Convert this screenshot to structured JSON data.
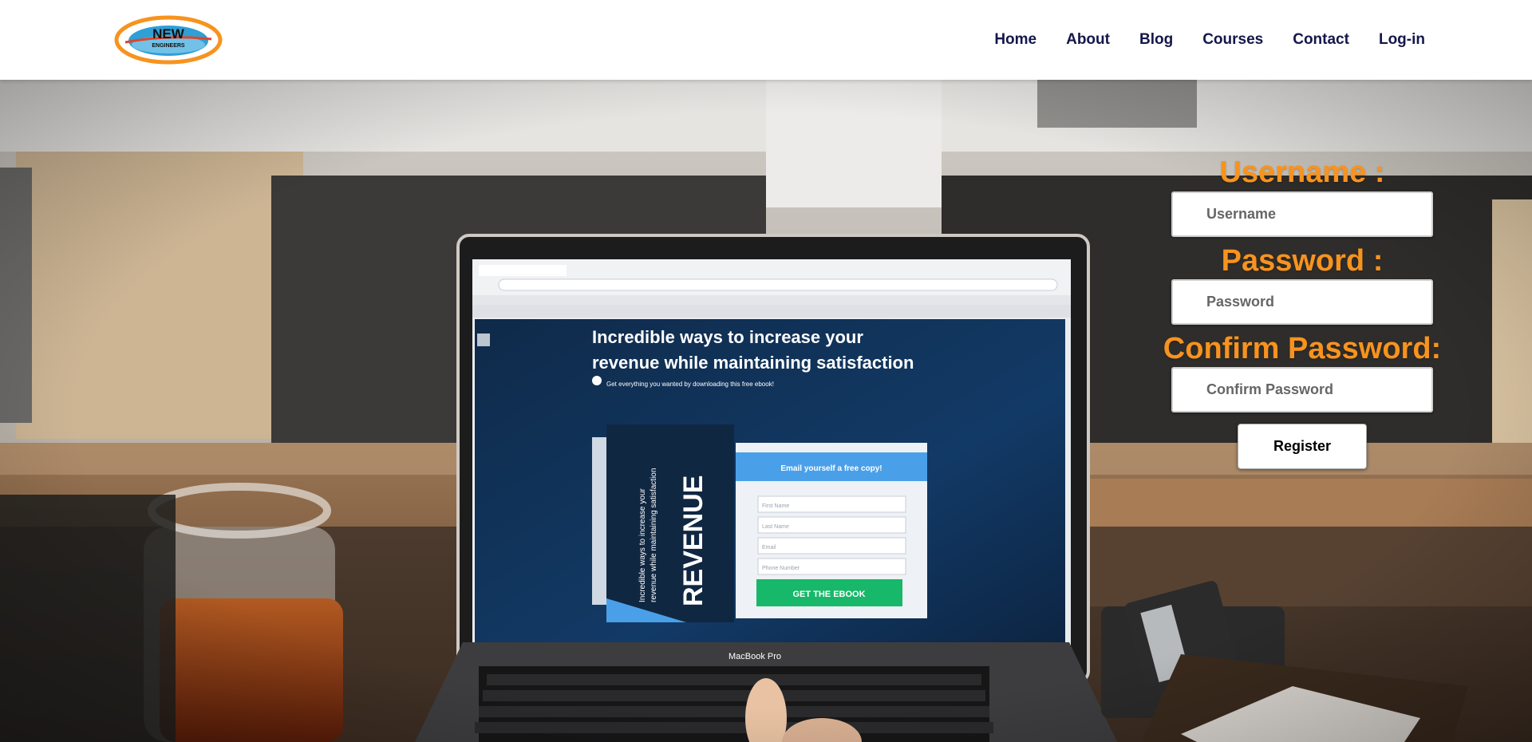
{
  "brand": {
    "logo_top": "NEW",
    "logo_bottom": "ENGINEERS",
    "colors": {
      "ring": "#f7931e",
      "disc": "#2f9fd6",
      "text": "#111111"
    }
  },
  "nav": {
    "home": "Home",
    "about": "About",
    "blog": "Blog",
    "courses": "Courses",
    "contact": "Contact",
    "login": "Log-in"
  },
  "screen": {
    "headline_1": "Incredible ways to increase your",
    "headline_2": "revenue while maintaining satisfaction",
    "subline": "Get everything you wanted by downloading this free ebook!",
    "book_title": "REVENUE",
    "book_sub_1": "Incredible ways to increase your",
    "book_sub_2": "revenue while maintaining satisfaction",
    "card_title": "Email yourself a free copy!",
    "field_1": "First Name",
    "field_2": "Last Name",
    "field_3": "Email",
    "field_4": "Phone Number",
    "cta": "GET THE EBOOK",
    "laptop_label": "MacBook Pro"
  },
  "form": {
    "username_label": "Username :",
    "username_placeholder": "Username",
    "password_label": "Password :",
    "password_placeholder": "Password",
    "confirm_label": "Confirm Password:",
    "confirm_placeholder": "Confirm Password",
    "register_label": "Register"
  },
  "colors": {
    "nav_text": "#14174a",
    "label_orange": "#f7931e",
    "cta_green": "#17b86a"
  }
}
